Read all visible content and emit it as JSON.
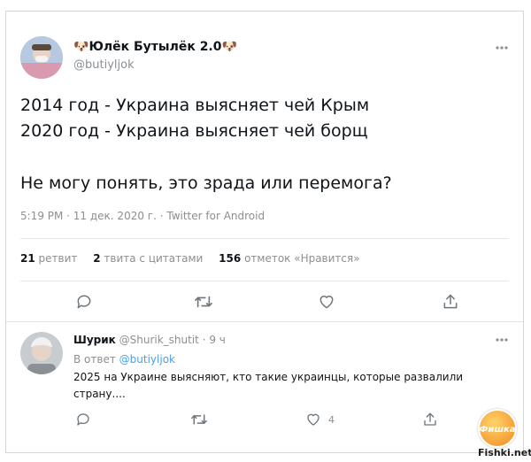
{
  "main_tweet": {
    "author_name": "Юлёк Бутылёк 2.0",
    "author_handle": "@butiyljok",
    "text_lines": [
      "2014 год - Украина выясняет чей Крым",
      "2020 год - Украина выясняет чей борщ",
      "Не могу понять, это зрада или перемога?"
    ],
    "meta": "5:19 PM · 11 дек. 2020 г. · Twitter for Android",
    "stats": {
      "retweets_count": "21",
      "retweets_label": "ретвит",
      "quotes_count": "2",
      "quotes_label": "твита с цитатами",
      "likes_count": "156",
      "likes_label": "отметок «Нравится»"
    }
  },
  "reply": {
    "author_name": "Шурик",
    "author_handle": "@Shurik_shutit",
    "time": "· 9 ч",
    "reply_prefix": "В ответ",
    "reply_to": "@butiyljok",
    "text_line1": "2025 на Украине выясняют, кто такие украинцы, которые развалили",
    "text_line2": "страну....",
    "like_count": "4"
  },
  "watermark": {
    "badge_text": "Фишка",
    "site": "Fishki.net"
  },
  "colors": {
    "accent": "#4a9fe8",
    "muted": "#8a8f94",
    "divider": "#e6e9ec"
  }
}
